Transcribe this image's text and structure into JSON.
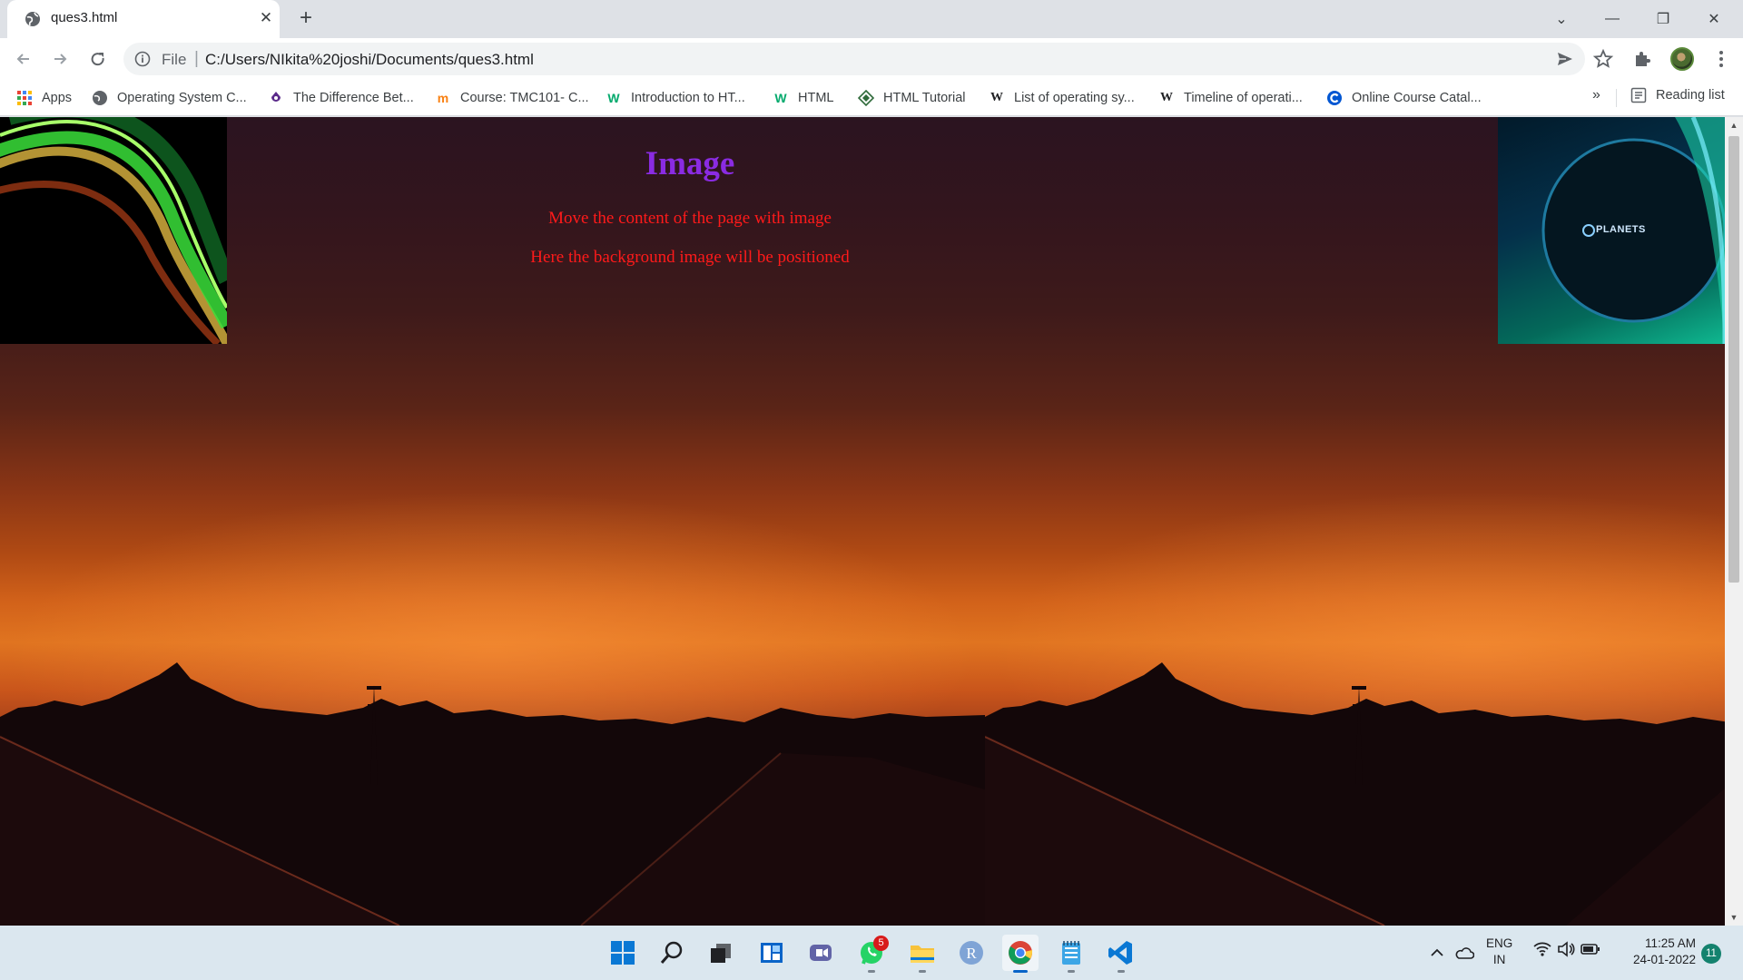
{
  "browser": {
    "tab": {
      "title": "ques3.html",
      "close": "✕"
    },
    "new_tab": "+",
    "window_controls": {
      "list": "⌄",
      "minimize": "—",
      "restore": "❐",
      "close": "✕"
    },
    "address": {
      "scheme": "File",
      "separator": "|",
      "url": "C:/Users/NIkita%20joshi/Documents/ques3.html"
    },
    "bookmarks": [
      {
        "label": "Apps",
        "icon": "apps-grid-icon"
      },
      {
        "label": "Operating System C...",
        "icon": "globe-icon"
      },
      {
        "label": "The Difference Bet...",
        "icon": "purple-drop-icon"
      },
      {
        "label": "Course: TMC101- C...",
        "icon": "moodle-icon"
      },
      {
        "label": "Introduction to HT...",
        "icon": "w3-icon"
      },
      {
        "label": "HTML",
        "icon": "w3-icon"
      },
      {
        "label": "HTML Tutorial",
        "icon": "diamond-icon"
      },
      {
        "label": "List of operating sy...",
        "icon": "wikipedia-icon"
      },
      {
        "label": "Timeline of operati...",
        "icon": "wikipedia-icon"
      },
      {
        "label": "Online Course Catal...",
        "icon": "coursera-icon"
      }
    ],
    "bookmarks_more": "»",
    "reading_list": "Reading list"
  },
  "page": {
    "heading": "Image",
    "line1": "Move the content of the page with image",
    "line2": "Here the background image will be positioned",
    "logo_text": "PLANETS"
  },
  "taskbar": {
    "apps": [
      "start-icon",
      "search-icon",
      "task-view-icon",
      "widgets-icon",
      "teams-chat-icon",
      "whatsapp-icon",
      "file-explorer-icon",
      "r-app-icon",
      "chrome-icon",
      "notepad-icon",
      "vscode-icon"
    ],
    "whatsapp_badge": "5",
    "tray_arrow": "^",
    "lang_line1": "ENG",
    "lang_line2": "IN",
    "time": "11:25 AM",
    "date": "24-01-2022",
    "notifications": "11"
  },
  "colors": {
    "heading": "#8a2be2",
    "text_red": "#ff1a1a",
    "chrome_blue": "#0a64c8"
  }
}
